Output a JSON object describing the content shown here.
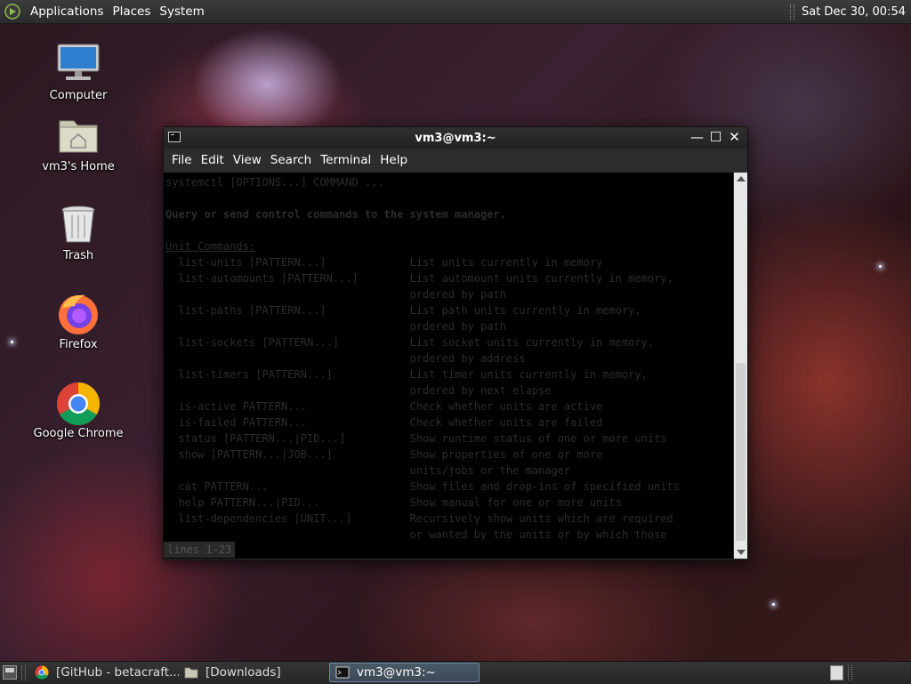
{
  "top_panel": {
    "menus": [
      "Applications",
      "Places",
      "System"
    ],
    "clock": "Sat Dec 30, 00:54"
  },
  "desktop": {
    "icons": [
      {
        "label": "Computer",
        "icon": "computer-icon"
      },
      {
        "label": "vm3's Home",
        "icon": "home-folder-icon"
      },
      {
        "label": "Trash",
        "icon": "trash-icon"
      },
      {
        "label": "Firefox",
        "icon": "firefox-icon"
      },
      {
        "label": "Google Chrome",
        "icon": "chrome-icon"
      }
    ]
  },
  "terminal": {
    "title": "vm3@vm3:~",
    "menu": [
      "File",
      "Edit",
      "View",
      "Search",
      "Terminal",
      "Help"
    ],
    "lines": [
      "systemctl [OPTIONS...] COMMAND ...",
      "",
      "Query or send control commands to the system manager.",
      "",
      "Unit Commands:",
      "  list-units [PATTERN...]             List units currently in memory",
      "  list-automounts [PATTERN...]        List automount units currently in memory,",
      "                                      ordered by path",
      "  list-paths [PATTERN...]             List path units currently in memory,",
      "                                      ordered by path",
      "  list-sockets [PATTERN...]           List socket units currently in memory,",
      "                                      ordered by address",
      "  list-timers [PATTERN...]            List timer units currently in memory,",
      "                                      ordered by next elapse",
      "  is-active PATTERN...                Check whether units are active",
      "  is-failed PATTERN...                Check whether units are failed",
      "  status [PATTERN...|PID...]          Show runtime status of one or more units",
      "  show [PATTERN...|JOB...]            Show properties of one or more",
      "                                      units/jobs or the manager",
      "  cat PATTERN...                      Show files and drop-ins of specified units",
      "  help PATTERN...|PID...              Show manual for one or more units",
      "  list-dependencies [UNIT...]         Recursively show units which are required",
      "                                      or wanted by the units or by which those"
    ],
    "pager_status": "lines 1-23"
  },
  "taskbar": {
    "tasks": [
      {
        "label": "[GitHub - betacraft...",
        "icon": "chrome-icon"
      },
      {
        "label": "[Downloads]",
        "icon": "folder-icon"
      },
      {
        "label": "vm3@vm3:~",
        "icon": "terminal-icon"
      }
    ]
  }
}
